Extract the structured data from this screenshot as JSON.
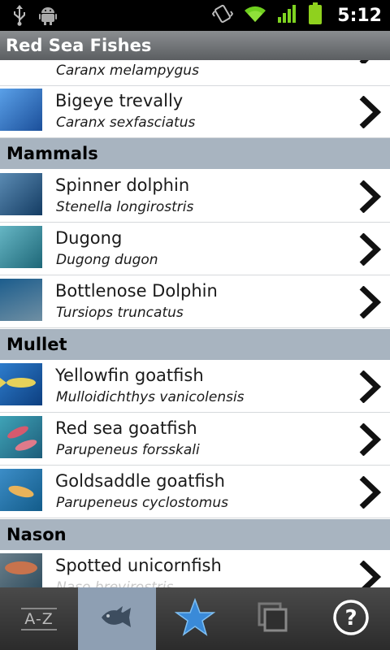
{
  "status_bar": {
    "time": "5:12"
  },
  "app": {
    "title": "Red Sea Fishes"
  },
  "rows": [
    {
      "name": "",
      "sci": "Caranx melampygus",
      "thumb_color": "#2f69b3"
    },
    {
      "name": "Bigeye trevally",
      "sci": "Caranx sexfasciatus",
      "thumb_color": "#1f63b0"
    },
    {
      "name": "Spinner dolphin",
      "sci": "Stenella longirostris",
      "thumb_color": "#2a6aa0"
    },
    {
      "name": "Dugong",
      "sci": "Dugong dugon",
      "thumb_color": "#3a8b9c"
    },
    {
      "name": "Bottlenose Dolphin",
      "sci": "Tursiops truncatus",
      "thumb_color": "#1e5f88"
    },
    {
      "name": "Yellowfin goatfish",
      "sci": "Mulloidichthys vanicolensis",
      "thumb_color": "#2c7fc0"
    },
    {
      "name": "Red sea goatfish",
      "sci": "Parupeneus forsskali",
      "thumb_color": "#2b93a8"
    },
    {
      "name": "Goldsaddle goatfish",
      "sci": "Parupeneus cyclostomus",
      "thumb_color": "#3d86b8"
    },
    {
      "name": "Spotted unicornfish",
      "sci": "Naso brevirostris",
      "thumb_color": "#5a7888"
    }
  ],
  "sections": {
    "mammals": "Mammals",
    "mullet": "Mullet",
    "nason": "Nason"
  },
  "tabs": {
    "az_label": "A-Z",
    "active_index": 1
  },
  "colors": {
    "section_bg": "#a8b4c0",
    "active_tab": "#8e9fb3",
    "chevron": "#111111"
  }
}
